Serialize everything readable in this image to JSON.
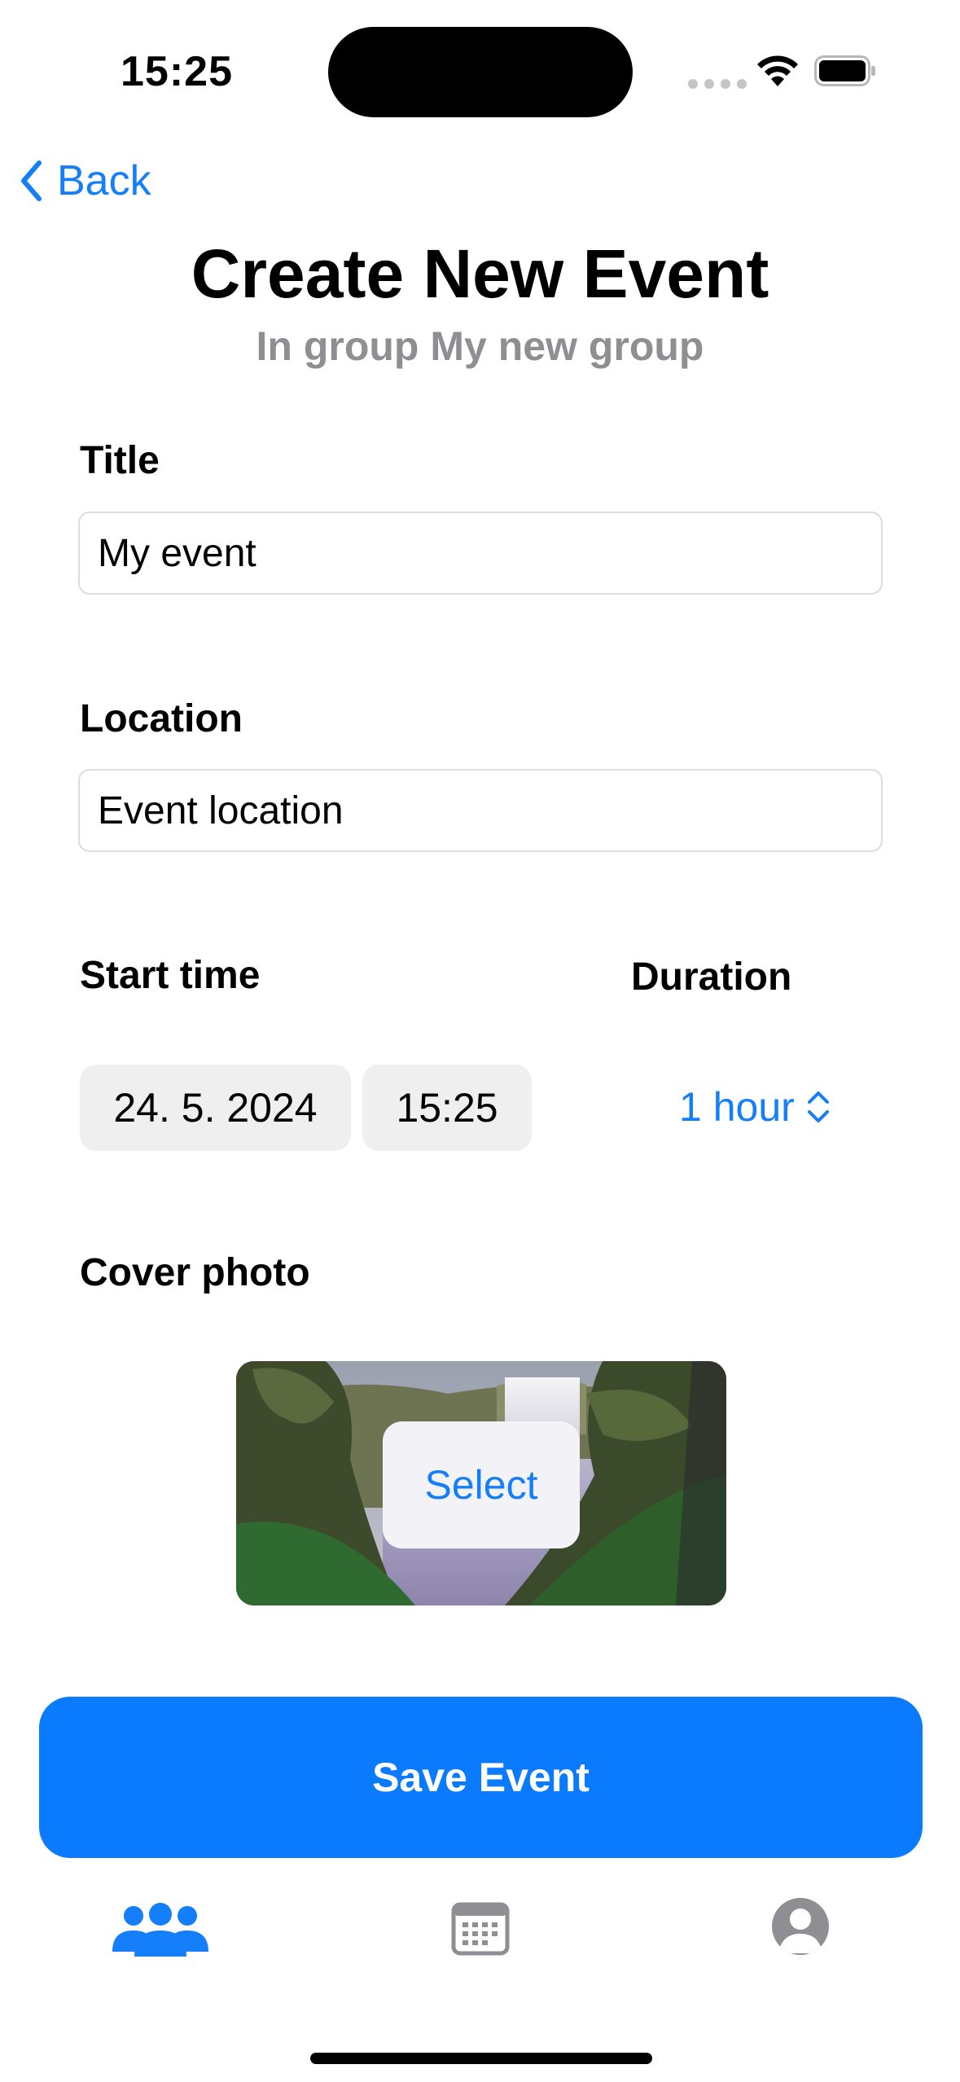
{
  "status_bar": {
    "time": "15:25"
  },
  "nav": {
    "back_label": "Back"
  },
  "header": {
    "title": "Create New Event",
    "subtitle": "In group My new group"
  },
  "form": {
    "title_label": "Title",
    "title_value": "My event",
    "location_label": "Location",
    "location_value": "Event location",
    "start_time_label": "Start time",
    "duration_label": "Duration",
    "start_date": "24. 5. 2024",
    "start_time": "15:25",
    "duration_value": "1 hour",
    "cover_photo_label": "Cover photo",
    "select_label": "Select"
  },
  "actions": {
    "save_label": "Save Event"
  },
  "tab_bar": {
    "items": [
      {
        "icon": "groups-icon",
        "active": true
      },
      {
        "icon": "calendar-icon",
        "active": false
      },
      {
        "icon": "profile-icon",
        "active": false
      }
    ]
  },
  "colors": {
    "accent": "#147efb",
    "primary_button": "#0a7aff",
    "secondary_text": "#8e8e93",
    "inactive_tab": "#8e8e93",
    "pill_background": "#efeff0"
  }
}
